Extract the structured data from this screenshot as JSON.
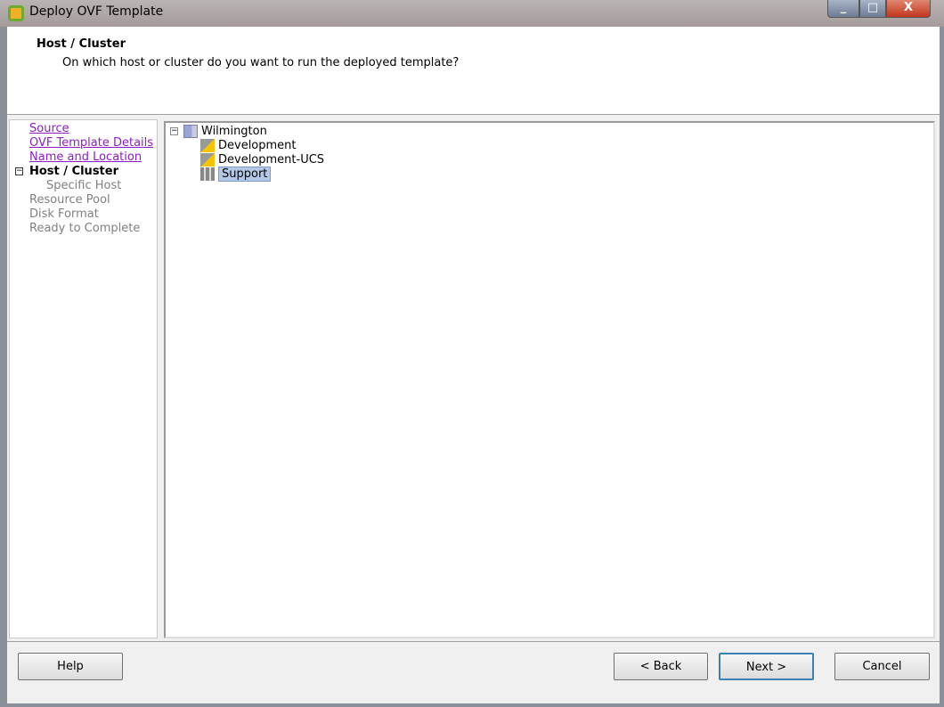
{
  "window": {
    "title": "Deploy OVF Template",
    "minimize": "_",
    "maximize": "□",
    "close": "X"
  },
  "header": {
    "title": "Host / Cluster",
    "subtitle": "On which host or cluster do you want to run the deployed template?"
  },
  "steps": [
    {
      "label": "Source",
      "state": "link"
    },
    {
      "label": "OVF Template Details",
      "state": "link"
    },
    {
      "label": "Name and Location",
      "state": "link"
    },
    {
      "label": "Host / Cluster",
      "state": "current"
    },
    {
      "label": "Specific Host",
      "state": "disabled"
    },
    {
      "label": "Resource Pool",
      "state": "disabled"
    },
    {
      "label": "Disk Format",
      "state": "disabled"
    },
    {
      "label": "Ready to Complete",
      "state": "disabled"
    }
  ],
  "tree": {
    "root": {
      "label": "Wilmington",
      "icon": "datacenter-icon",
      "expanded": true
    },
    "children": [
      {
        "label": "Development",
        "icon": "cluster-warning-icon"
      },
      {
        "label": "Development-UCS",
        "icon": "cluster-warning-icon"
      },
      {
        "label": "Support",
        "icon": "cluster-icon",
        "selected": true
      }
    ]
  },
  "buttons": {
    "help": "Help",
    "back": "< Back",
    "next": "Next >",
    "cancel": "Cancel"
  }
}
